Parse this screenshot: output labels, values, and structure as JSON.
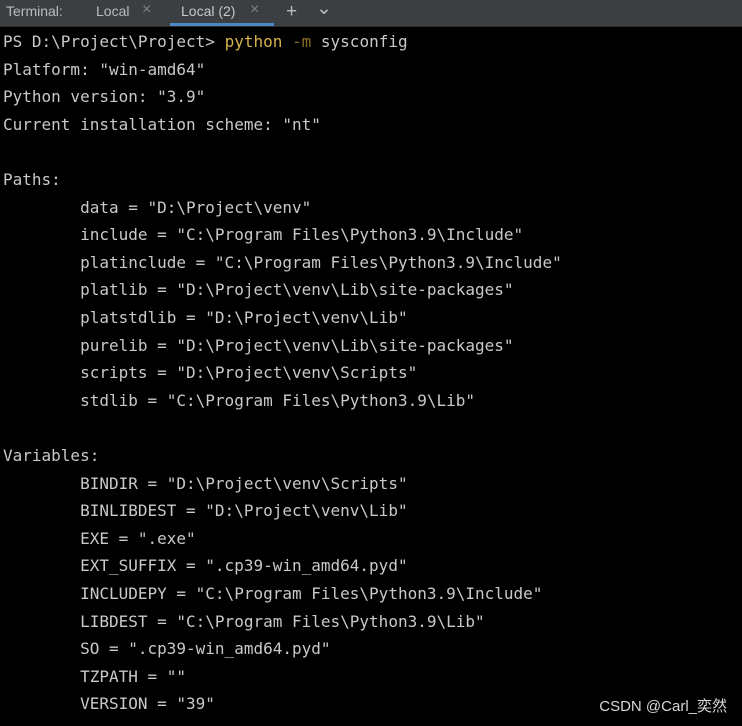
{
  "tabbar": {
    "label": "Terminal:",
    "tabs": [
      {
        "label": "Local",
        "active": false
      },
      {
        "label": "Local (2)",
        "active": true
      }
    ],
    "close_glyph": "×",
    "add_glyph": "+",
    "dropdown_glyph": "⌄"
  },
  "terminal": {
    "prompt": "PS D:\\Project\\Project>",
    "command": "python",
    "flag": "-m",
    "argument": "sysconfig",
    "lines": [
      "Platform: \"win-amd64\"",
      "Python version: \"3.9\"",
      "Current installation scheme: \"nt\"",
      "",
      "Paths:",
      "        data = \"D:\\Project\\venv\"",
      "        include = \"C:\\Program Files\\Python3.9\\Include\"",
      "        platinclude = \"C:\\Program Files\\Python3.9\\Include\"",
      "        platlib = \"D:\\Project\\venv\\Lib\\site-packages\"",
      "        platstdlib = \"D:\\Project\\venv\\Lib\"",
      "        purelib = \"D:\\Project\\venv\\Lib\\site-packages\"",
      "        scripts = \"D:\\Project\\venv\\Scripts\"",
      "        stdlib = \"C:\\Program Files\\Python3.9\\Lib\"",
      "",
      "Variables:",
      "        BINDIR = \"D:\\Project\\venv\\Scripts\"",
      "        BINLIBDEST = \"D:\\Project\\venv\\Lib\"",
      "        EXE = \".exe\"",
      "        EXT_SUFFIX = \".cp39-win_amd64.pyd\"",
      "        INCLUDEPY = \"C:\\Program Files\\Python3.9\\Include\"",
      "        LIBDEST = \"C:\\Program Files\\Python3.9\\Lib\"",
      "        SO = \".cp39-win_amd64.pyd\"",
      "        TZPATH = \"\"",
      "        VERSION = \"39\""
    ]
  },
  "watermark": "CSDN @Carl_奕然",
  "colors": {
    "background": "#000000",
    "tabbar": "#3c3f41",
    "text": "#c9c9c9",
    "command": "#d4b34b",
    "active_tab_underline": "#4a88c7"
  }
}
